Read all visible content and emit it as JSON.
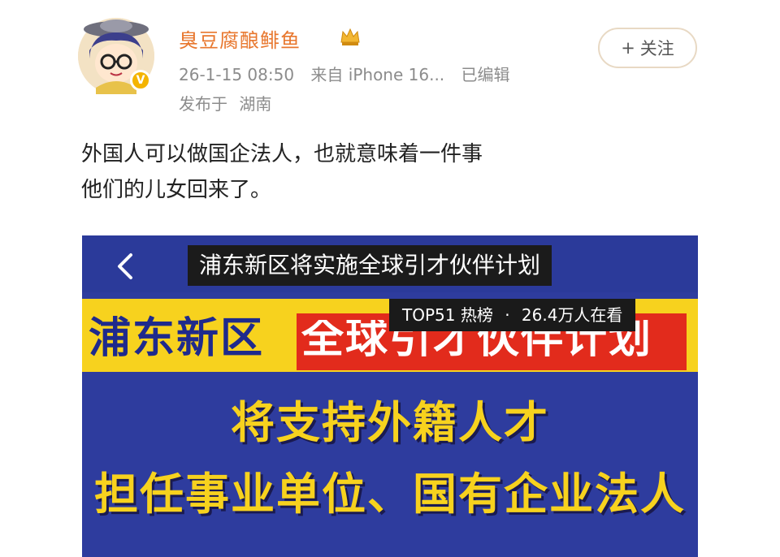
{
  "author": {
    "name": "臭豆腐酿鲱鱼",
    "timestamp": "26-1-15 08:50",
    "source": "来自 iPhone 16...",
    "edited": "已编辑",
    "location_prefix": "发布于",
    "location": "湖南"
  },
  "follow_button": {
    "plus": "+",
    "label": "关注"
  },
  "post": {
    "lines": [
      "外国人可以做国企法人，也就意味着一件事",
      "他们的儿女回来了。"
    ]
  },
  "video": {
    "title": "浦东新区将实施全球引才伙伴计划",
    "banner_left": "浦东新区",
    "banner_right": "全球引才伙伴计划",
    "hot_rank": "TOP51 热榜",
    "dot": "·",
    "viewers": "26.4万人在看",
    "line1": "将支持外籍人才",
    "line2": "担任事业单位、国有企业法人"
  },
  "colors": {
    "username": "#e8772e",
    "meta": "#8c8c8c",
    "video_bg": "#2e3c9e",
    "banner_yellow": "#f7d21e",
    "banner_red": "#e22b1c",
    "caption_yellow": "#f7d21e"
  },
  "icons": {
    "avatar": "cartoon-avatar-icon",
    "verify": "verified-badge-icon",
    "crown": "crown-icon",
    "back": "back-arrow-icon"
  }
}
